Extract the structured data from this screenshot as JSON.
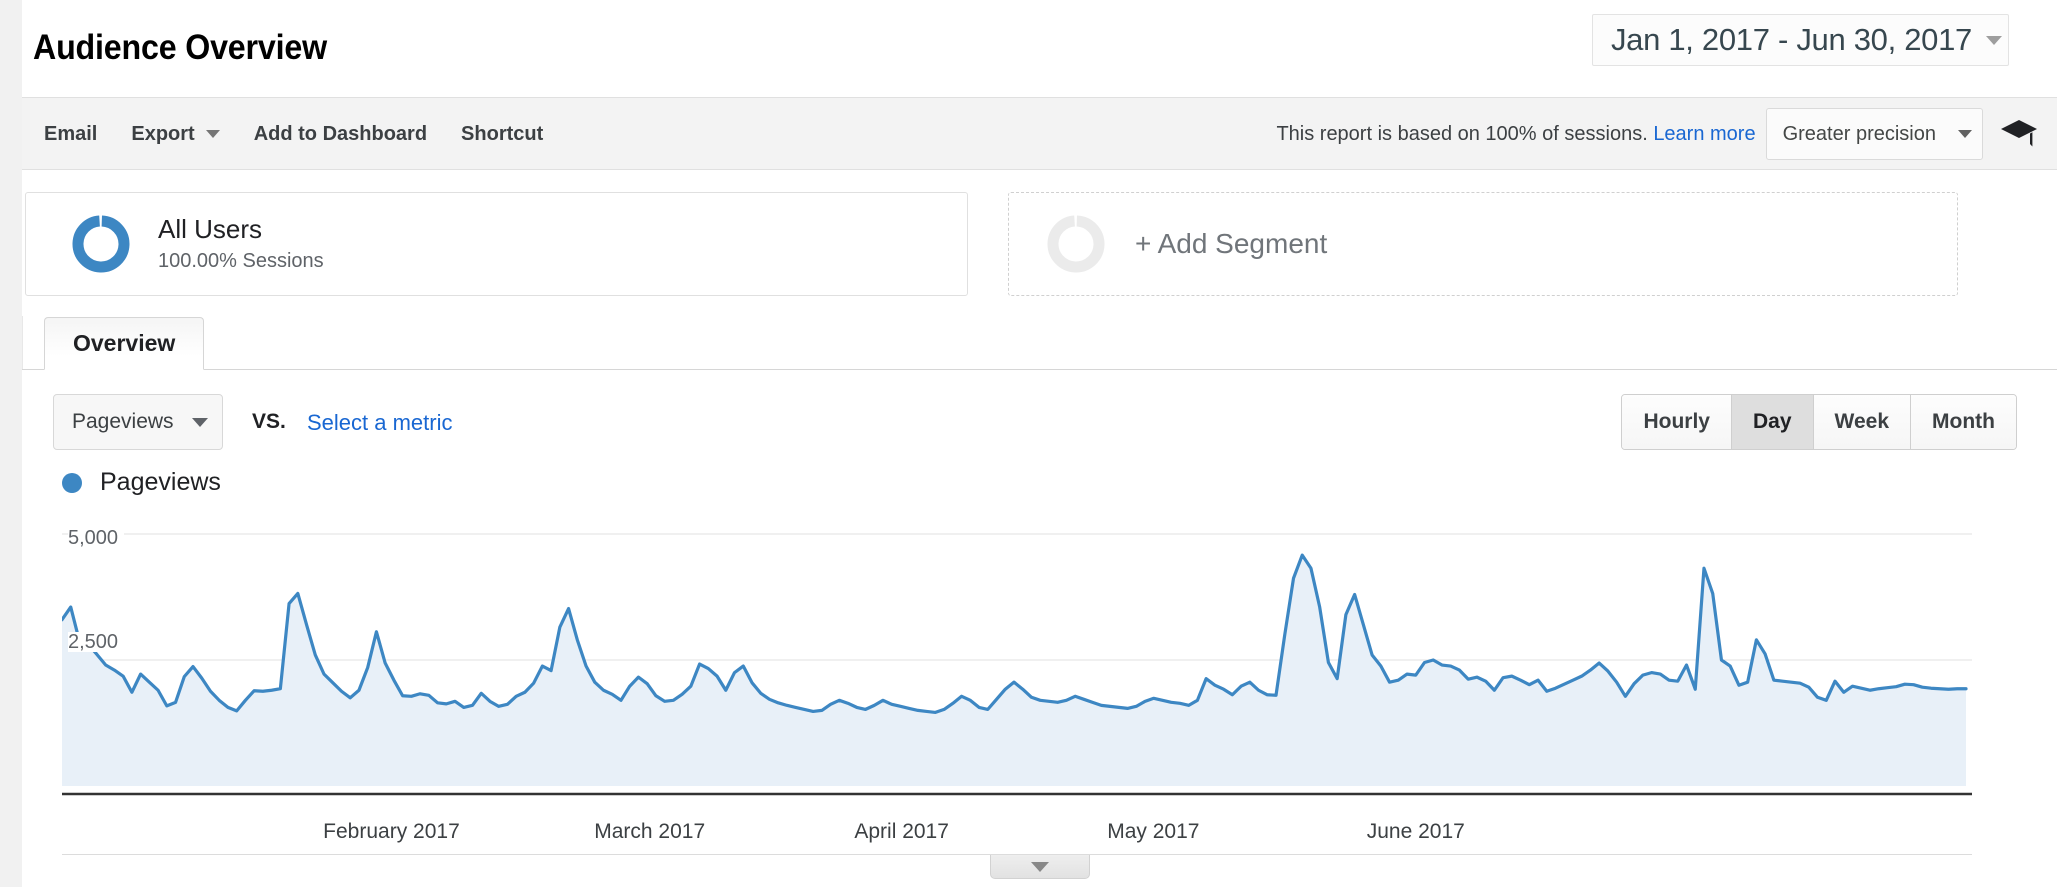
{
  "header": {
    "title": "Audience Overview",
    "date_range": "Jan 1, 2017 - Jun 30, 2017",
    "date_caret_icon": "chevron-down-icon"
  },
  "toolbar": {
    "email_label": "Email",
    "export_label": "Export",
    "export_caret_icon": "chevron-down-icon",
    "add_to_dashboard_label": "Add to Dashboard",
    "shortcut_label": "Shortcut",
    "sampling_note": "This report is based on 100% of sessions.",
    "learn_more_label": "Learn more",
    "precision_label": "Greater precision",
    "precision_caret_icon": "chevron-down-icon",
    "help_icon": "graduation-cap-icon"
  },
  "segments": {
    "all_users": {
      "title": "All Users",
      "subtitle": "100.00% Sessions",
      "donut_icon": "donut-ring-icon",
      "donut_color": "#3d87c3"
    },
    "add_segment": {
      "label": "+ Add Segment",
      "donut_icon": "donut-ring-icon",
      "donut_color": "#ebebeb"
    }
  },
  "tabs": [
    {
      "label": "Overview",
      "active": true
    }
  ],
  "controls": {
    "metric_selected": "Pageviews",
    "metric_caret_icon": "chevron-down-icon",
    "vs_label": "VS.",
    "select_metric_label": "Select a metric",
    "granularity": [
      {
        "label": "Hourly",
        "active": false
      },
      {
        "label": "Day",
        "active": true
      },
      {
        "label": "Week",
        "active": false
      },
      {
        "label": "Month",
        "active": false
      }
    ]
  },
  "chart_data": {
    "type": "area",
    "title": "Pageviews",
    "legend": [
      {
        "label": "Pageviews",
        "color": "#3d87c3"
      }
    ],
    "legend_position": "top-left",
    "xlabel": "",
    "ylabel": "Pageviews",
    "ylim": [
      0,
      5000
    ],
    "yticks": [
      2500,
      5000
    ],
    "ytick_labels": [
      "2,500",
      "5,000"
    ],
    "grid": true,
    "x_range": [
      "2017-01-01",
      "2017-06-30"
    ],
    "xtick_labels": [
      "February 2017",
      "March 2017",
      "April 2017",
      "May 2017",
      "June 2017"
    ],
    "xtick_positions": [
      0.1725,
      0.3077,
      0.4396,
      0.5714,
      0.7088
    ],
    "line_color": "#3d87c3",
    "fill_color": "#e8f0f8",
    "series": [
      {
        "name": "Pageviews",
        "values": [
          3300,
          3550,
          2870,
          2810,
          2610,
          2400,
          2300,
          2180,
          1860,
          2220,
          2060,
          1900,
          1590,
          1660,
          2170,
          2370,
          2140,
          1880,
          1700,
          1560,
          1490,
          1700,
          1890,
          1880,
          1900,
          1930,
          3620,
          3820,
          3200,
          2600,
          2220,
          2050,
          1880,
          1750,
          1900,
          2350,
          3060,
          2440,
          2100,
          1790,
          1780,
          1830,
          1800,
          1650,
          1630,
          1680,
          1560,
          1600,
          1840,
          1680,
          1580,
          1620,
          1780,
          1860,
          2040,
          2380,
          2290,
          3150,
          3520,
          2900,
          2380,
          2060,
          1900,
          1820,
          1700,
          1980,
          2160,
          2030,
          1790,
          1680,
          1700,
          1820,
          1980,
          2420,
          2330,
          2180,
          1900,
          2250,
          2380,
          2050,
          1840,
          1720,
          1650,
          1600,
          1560,
          1520,
          1480,
          1500,
          1620,
          1700,
          1640,
          1560,
          1520,
          1600,
          1700,
          1620,
          1580,
          1540,
          1500,
          1480,
          1460,
          1520,
          1640,
          1780,
          1700,
          1560,
          1520,
          1720,
          1920,
          2060,
          1920,
          1760,
          1700,
          1680,
          1660,
          1700,
          1780,
          1720,
          1660,
          1600,
          1580,
          1560,
          1540,
          1580,
          1680,
          1740,
          1700,
          1660,
          1640,
          1600,
          1700,
          2130,
          2000,
          1920,
          1810,
          1980,
          2060,
          1900,
          1810,
          1800,
          3000,
          4120,
          4580,
          4320,
          3550,
          2450,
          2130,
          3400,
          3800,
          3200,
          2600,
          2380,
          2060,
          2100,
          2220,
          2200,
          2450,
          2500,
          2400,
          2380,
          2300,
          2120,
          2160,
          2080,
          1900,
          2150,
          2180,
          2100,
          2010,
          2100,
          1880,
          1940,
          2020,
          2100,
          2180,
          2300,
          2440,
          2280,
          2060,
          1780,
          2030,
          2200,
          2250,
          2220,
          2100,
          2080,
          2400,
          1920,
          4320,
          3820,
          2500,
          2380,
          2000,
          2060,
          2900,
          2620,
          2100,
          2080,
          2060,
          2040,
          1960,
          1760,
          1700,
          2080,
          1860,
          1980,
          1940,
          1900,
          1930,
          1950,
          1970,
          2020,
          2010,
          1960,
          1940,
          1930,
          1920,
          1930,
          1930
        ]
      }
    ]
  },
  "expander": {
    "icon": "chevron-down-icon"
  }
}
